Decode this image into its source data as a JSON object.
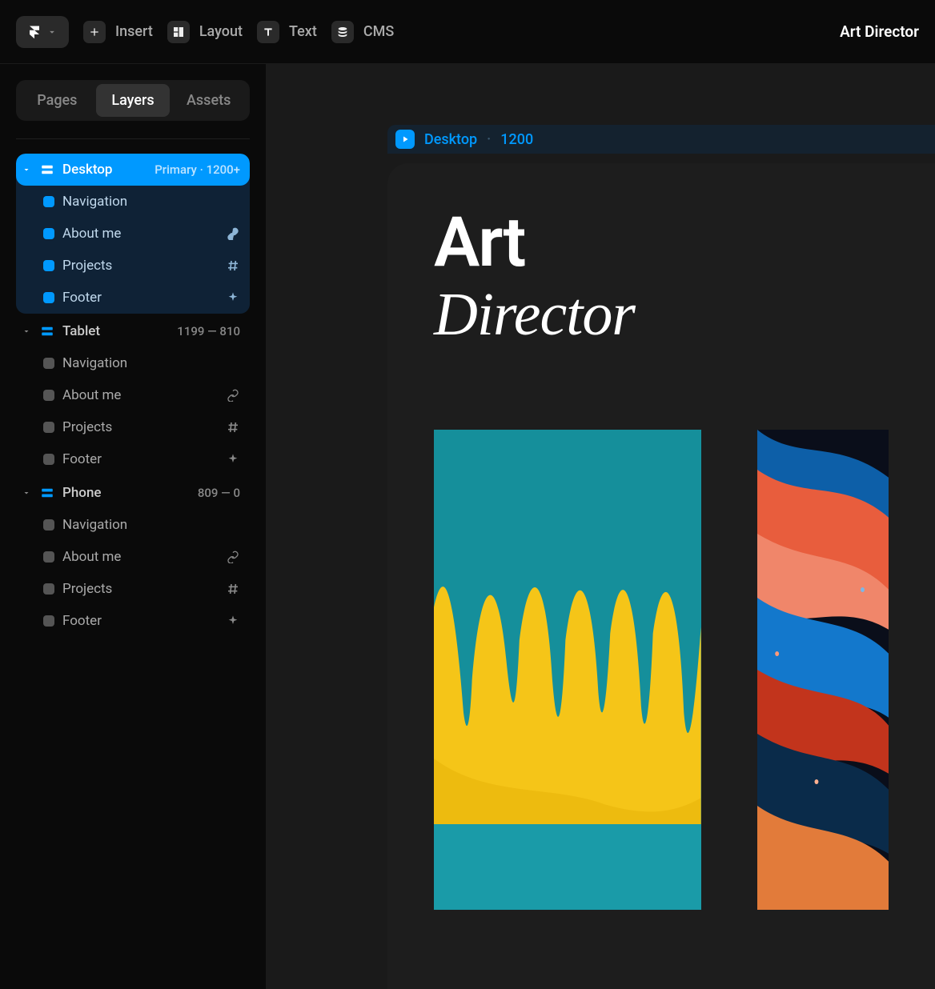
{
  "topbar": {
    "items": [
      {
        "label": "Insert"
      },
      {
        "label": "Layout"
      },
      {
        "label": "Text"
      },
      {
        "label": "CMS"
      }
    ],
    "project_name": "Art Director"
  },
  "sidebar": {
    "tabs": [
      {
        "label": "Pages"
      },
      {
        "label": "Layers"
      },
      {
        "label": "Assets"
      }
    ],
    "breakpoints": [
      {
        "name": "Desktop",
        "meta": "Primary · 1200+",
        "primary": true,
        "children": [
          {
            "label": "Navigation",
            "suffix": ""
          },
          {
            "label": "About me",
            "suffix": "link"
          },
          {
            "label": "Projects",
            "suffix": "hash"
          },
          {
            "label": "Footer",
            "suffix": "sparkle"
          }
        ]
      },
      {
        "name": "Tablet",
        "meta": "1199 — 810",
        "primary": false,
        "children": [
          {
            "label": "Navigation",
            "suffix": ""
          },
          {
            "label": "About me",
            "suffix": "link"
          },
          {
            "label": "Projects",
            "suffix": "hash"
          },
          {
            "label": "Footer",
            "suffix": "sparkle"
          }
        ]
      },
      {
        "name": "Phone",
        "meta": "809 — 0",
        "primary": false,
        "children": [
          {
            "label": "Navigation",
            "suffix": ""
          },
          {
            "label": "About me",
            "suffix": "link"
          },
          {
            "label": "Projects",
            "suffix": "hash"
          },
          {
            "label": "Footer",
            "suffix": "sparkle"
          }
        ]
      }
    ]
  },
  "canvas": {
    "frame_name": "Desktop",
    "frame_size": "1200",
    "hero_line1": "Art",
    "hero_line2": "Director"
  }
}
